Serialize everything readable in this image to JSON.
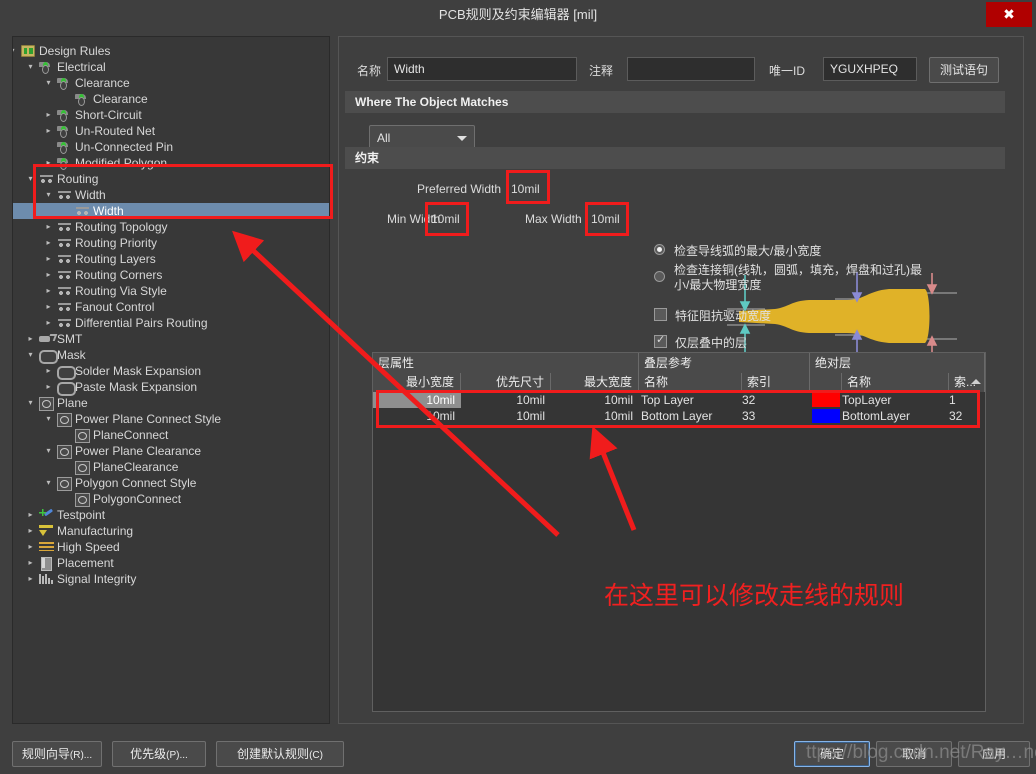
{
  "window": {
    "title": "PCB规则及约束编辑器 [mil]",
    "close_label": "✖"
  },
  "tree": {
    "items": [
      {
        "label": "Design Rules",
        "indent": 0,
        "expander": "▾",
        "icon": "folder-icon",
        "selected": false
      },
      {
        "label": "Electrical",
        "indent": 1,
        "expander": "▾",
        "icon": "electrical-icon",
        "selected": false
      },
      {
        "label": "Clearance",
        "indent": 2,
        "expander": "▾",
        "icon": "electrical-icon",
        "selected": false
      },
      {
        "label": "Clearance",
        "indent": 3,
        "expander": "",
        "icon": "electrical-icon",
        "selected": false
      },
      {
        "label": "Short-Circuit",
        "indent": 2,
        "expander": "▸",
        "icon": "electrical-icon",
        "selected": false
      },
      {
        "label": "Un-Routed Net",
        "indent": 2,
        "expander": "▸",
        "icon": "electrical-icon",
        "selected": false
      },
      {
        "label": "Un-Connected Pin",
        "indent": 2,
        "expander": "",
        "icon": "electrical-icon",
        "selected": false
      },
      {
        "label": "Modified Polygon",
        "indent": 2,
        "expander": "▸",
        "icon": "electrical-icon",
        "selected": false
      },
      {
        "label": "Routing",
        "indent": 1,
        "expander": "▾",
        "icon": "routing-icon",
        "selected": false
      },
      {
        "label": "Width",
        "indent": 2,
        "expander": "▾",
        "icon": "routing-icon",
        "selected": false
      },
      {
        "label": "Width",
        "indent": 3,
        "expander": "",
        "icon": "routing-icon",
        "selected": true
      },
      {
        "label": "Routing Topology",
        "indent": 2,
        "expander": "▸",
        "icon": "routing-icon",
        "selected": false
      },
      {
        "label": "Routing Priority",
        "indent": 2,
        "expander": "▸",
        "icon": "routing-icon",
        "selected": false
      },
      {
        "label": "Routing Layers",
        "indent": 2,
        "expander": "▸",
        "icon": "routing-icon",
        "selected": false
      },
      {
        "label": "Routing Corners",
        "indent": 2,
        "expander": "▸",
        "icon": "routing-icon",
        "selected": false
      },
      {
        "label": "Routing Via Style",
        "indent": 2,
        "expander": "▸",
        "icon": "routing-icon",
        "selected": false
      },
      {
        "label": "Fanout Control",
        "indent": 2,
        "expander": "▸",
        "icon": "routing-icon",
        "selected": false
      },
      {
        "label": "Differential Pairs Routing",
        "indent": 2,
        "expander": "▸",
        "icon": "routing-icon",
        "selected": false
      },
      {
        "label": "SMT",
        "indent": 1,
        "expander": "▸",
        "icon": "smt-icon",
        "selected": false
      },
      {
        "label": "Mask",
        "indent": 1,
        "expander": "▾",
        "icon": "mask-icon",
        "selected": false
      },
      {
        "label": "Solder Mask Expansion",
        "indent": 2,
        "expander": "▸",
        "icon": "mask-icon",
        "selected": false
      },
      {
        "label": "Paste Mask Expansion",
        "indent": 2,
        "expander": "▸",
        "icon": "mask-icon",
        "selected": false
      },
      {
        "label": "Plane",
        "indent": 1,
        "expander": "▾",
        "icon": "plane-icon",
        "selected": false
      },
      {
        "label": "Power Plane Connect Style",
        "indent": 2,
        "expander": "▾",
        "icon": "plane-icon",
        "selected": false
      },
      {
        "label": "PlaneConnect",
        "indent": 3,
        "expander": "",
        "icon": "plane-icon",
        "selected": false
      },
      {
        "label": "Power Plane Clearance",
        "indent": 2,
        "expander": "▾",
        "icon": "plane-icon",
        "selected": false
      },
      {
        "label": "PlaneClearance",
        "indent": 3,
        "expander": "",
        "icon": "plane-icon",
        "selected": false
      },
      {
        "label": "Polygon Connect Style",
        "indent": 2,
        "expander": "▾",
        "icon": "plane-icon",
        "selected": false
      },
      {
        "label": "PolygonConnect",
        "indent": 3,
        "expander": "",
        "icon": "plane-icon",
        "selected": false
      },
      {
        "label": "Testpoint",
        "indent": 1,
        "expander": "▸",
        "icon": "testpoint-icon",
        "selected": false
      },
      {
        "label": "Manufacturing",
        "indent": 1,
        "expander": "▸",
        "icon": "manufacturing-icon",
        "selected": false
      },
      {
        "label": "High Speed",
        "indent": 1,
        "expander": "▸",
        "icon": "highspeed-icon",
        "selected": false
      },
      {
        "label": "Placement",
        "indent": 1,
        "expander": "▸",
        "icon": "placement-icon",
        "selected": false
      },
      {
        "label": "Signal Integrity",
        "indent": 1,
        "expander": "▸",
        "icon": "signalintegrity-icon",
        "selected": false
      }
    ]
  },
  "form": {
    "name_label": "名称",
    "name_value": "Width",
    "comment_label": "注释",
    "comment_value": "",
    "uniqueid_label": "唯一ID",
    "uniqueid_value": "YGUXHPEQ",
    "test_query_button": "测试语句"
  },
  "where_section": {
    "header": "Where The Object Matches",
    "scope_value": "All"
  },
  "constraints_section": {
    "header": "约束",
    "preferred_width_label": "Preferred Width",
    "preferred_width_value": "10mil",
    "min_width_label": "Min Width",
    "min_width_value": "10mil",
    "max_width_label": "Max Width",
    "max_width_value": "10mil",
    "radio_1": "检查导线弧的最大/最小宽度",
    "radio_2_line1": "检查连接铜(线轨，圆弧，填充，焊盘和过孔)最",
    "radio_2_line2": "小/最大物理宽度",
    "radio_selected": 1,
    "check_impedance_label": "特征阻抗驱动宽度",
    "check_impedance_checked": false,
    "check_stackup_label": "仅层叠中的层",
    "check_stackup_checked": true
  },
  "table": {
    "group_headers": [
      {
        "label": "层属性"
      },
      {
        "label": "叠层参考"
      },
      {
        "label": "绝对层"
      }
    ],
    "columns": [
      "最小宽度",
      "优先尺寸",
      "最大宽度",
      "名称",
      "索引",
      "",
      "名称",
      "索..."
    ],
    "rows": [
      {
        "min_width": "10mil",
        "preferred": "10mil",
        "max_width": "10mil",
        "stack_name": "Top Layer",
        "stack_index": "32",
        "abs_color": "#ff0000",
        "abs_name": "TopLayer",
        "abs_index": "1"
      },
      {
        "min_width": "10mil",
        "preferred": "10mil",
        "max_width": "10mil",
        "stack_name": "Bottom Layer",
        "stack_index": "33",
        "abs_color": "#0000ff",
        "abs_name": "BottomLayer",
        "abs_index": "32"
      }
    ]
  },
  "annotation": {
    "note_text": "在这里可以修改走线的规则",
    "note_color": "#f02020"
  },
  "footer": {
    "rule_wizard": "规则向导",
    "rule_wizard_accel": "(R)...",
    "priority": "优先级",
    "priority_accel": "(P)...",
    "create_default": "创建默认规则",
    "create_default_accel": "(C)",
    "ok": "确定",
    "cancel": "取消",
    "apply": "应用",
    "watermark": "ttps://blog.csdn.net/Ray…ne_"
  }
}
